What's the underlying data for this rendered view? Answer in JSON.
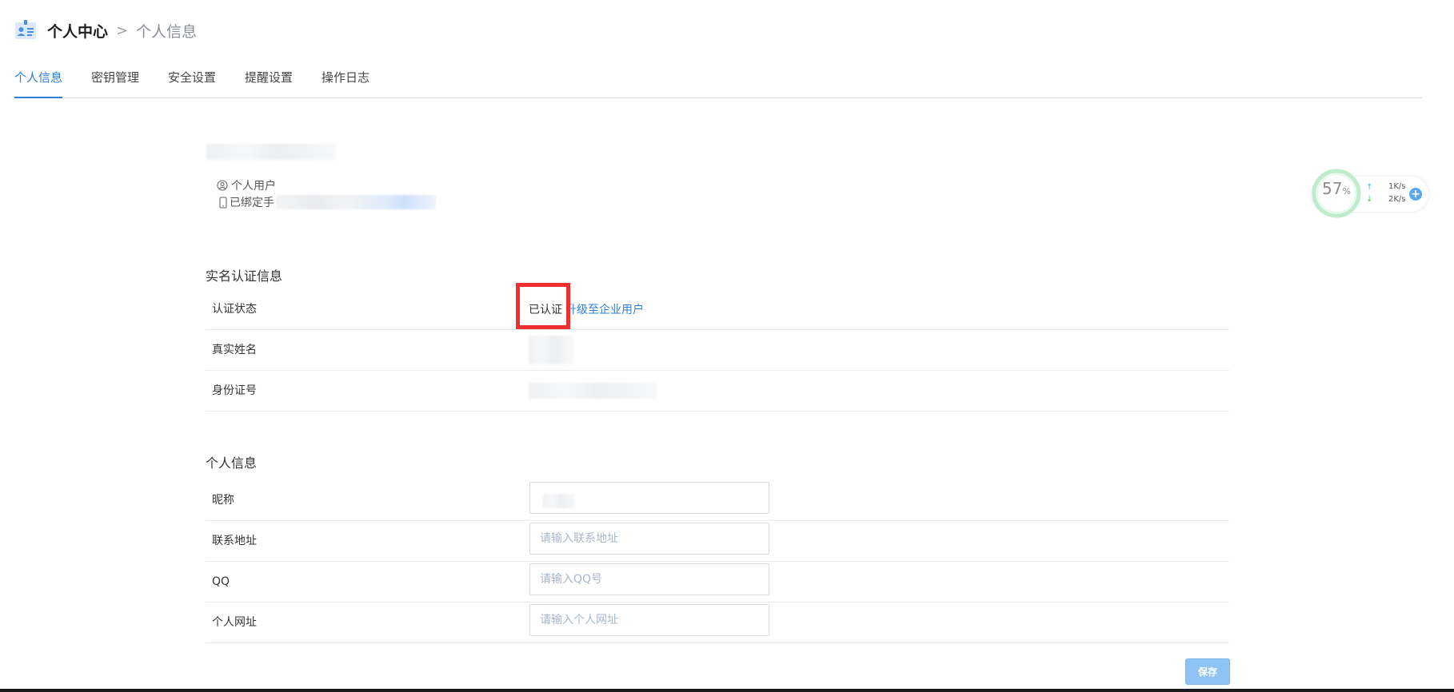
{
  "header": {
    "breadcrumb_root": "个人中心",
    "breadcrumb_separator": ">",
    "breadcrumb_current": "个人信息"
  },
  "tabs": [
    {
      "label": "个人信息",
      "active": true
    },
    {
      "label": "密钥管理",
      "active": false
    },
    {
      "label": "安全设置",
      "active": false
    },
    {
      "label": "提醒设置",
      "active": false
    },
    {
      "label": "操作日志",
      "active": false
    }
  ],
  "profile": {
    "user_type": "个人用户",
    "phone_label": "已绑定手"
  },
  "realname": {
    "title": "实名认证信息",
    "status_label": "认证状态",
    "status_value": "已认证",
    "upgrade_link": "升级至企业用户",
    "name_label": "真实姓名",
    "id_label": "身份证号"
  },
  "personal": {
    "title": "个人信息",
    "nickname_label": "昵称",
    "address_label": "联系地址",
    "address_placeholder": "请输入联系地址",
    "qq_label": "QQ",
    "qq_placeholder": "请输入QQ号",
    "website_label": "个人网址",
    "website_placeholder": "请输入个人网址"
  },
  "save_label": "保存",
  "net_widget": {
    "percent": "57",
    "percent_sign": "%",
    "up_speed": "1K/s",
    "down_speed": "2K/s",
    "up_arrow": "↑",
    "down_arrow": "↓",
    "plus": "+"
  },
  "colors": {
    "accent": "#2f7fd6",
    "highlight": "#ee2f2f",
    "save_button": "#8fc3f5"
  }
}
